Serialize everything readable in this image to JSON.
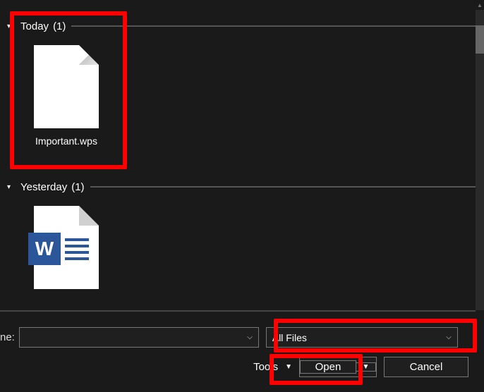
{
  "groups": [
    {
      "label": "Today",
      "count": "(1)",
      "items": [
        {
          "name": "Important.wps",
          "kind": "blank"
        }
      ]
    },
    {
      "label": "Yesterday",
      "count": "(1)",
      "items": [
        {
          "name": "",
          "kind": "word"
        }
      ]
    }
  ],
  "footer": {
    "filename_label": "ne:",
    "filename_value": "",
    "filter_value": "All Files",
    "tools_label": "Tools",
    "open_label": "Open",
    "cancel_label": "Cancel"
  }
}
